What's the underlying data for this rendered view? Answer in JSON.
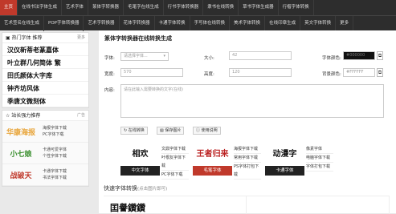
{
  "nav": {
    "row1": [
      "主页",
      "在线书法字体生成",
      "艺术字体",
      "篆体字转换器",
      "毛笔字在线生成",
      "行书字体转换器",
      "隶书在线转换",
      "草书字体生成器",
      "行楷字体转换"
    ],
    "row2": [
      "艺术签名在线生成",
      "POP字体转换器",
      "艺术字转换器",
      "花体字转换器",
      "卡通字体转换",
      "手写体在线转换",
      "美术字体转换",
      "在线印章生成",
      "英文字体转换",
      "更多"
    ]
  },
  "sidebar": {
    "hot_title": "热门字体 推荐",
    "hot_more": "更多",
    "fonts": [
      "汉仪新蒂老篆嘉体",
      "叶立群几何简体 繁",
      "田氏颜体大字库",
      "钟齐坊风体",
      "季唐文微刻体"
    ],
    "promo_title": "站长强力推荐",
    "promo_ad": "广告",
    "promos": [
      {
        "art": "华康海报",
        "links": [
          "海报字体下载",
          "PC字体下载"
        ],
        "color": "#e8a53a"
      },
      {
        "art": "小七娘",
        "links": [
          "卡通可爱字体",
          "个性字体下载"
        ],
        "color": "#3a8f2e"
      },
      {
        "art": "战破天",
        "links": [
          "卡通字体下载",
          "书法字体下载"
        ],
        "color": "#c0392b"
      }
    ]
  },
  "main": {
    "title": "篆体字转换器在线转换生成",
    "font_label": "字体:",
    "font_value": "请选择字体...",
    "size_label": "大小:",
    "size_value": "42",
    "color_label": "字体颜色:",
    "color_value": "#000000",
    "width_label": "宽度:",
    "width_value": "570",
    "height_label": "高度:",
    "height_value": "120",
    "bg_label": "背景颜色:",
    "bg_value": "#FFFFFF",
    "content_label": "内容:",
    "content_placeholder": "请在此输入需要转换的文字(在线)",
    "btn_convert": "在线转换",
    "btn_save": "保存图片",
    "btn_help": "使用说明",
    "samples": [
      {
        "art": "相欢",
        "cap": "中文字体",
        "capcolor": "#222",
        "links": [
          "文鼎字体下载",
          "叶根友字体下载",
          "PC字体下载"
        ]
      },
      {
        "art": "王者归来",
        "cap": "毛笔字体",
        "capcolor": "#c0392b",
        "links": [
          "海报字体下载",
          "常用字体下载",
          "PS字体打包下载"
        ]
      },
      {
        "art": "动漫字",
        "cap": "卡通字体",
        "capcolor": "#222",
        "links": [
          "像素字体",
          "电脑字体下载",
          "字体打包下载"
        ]
      }
    ],
    "section_title": "快速字体转换",
    "section_hint": "(点击图片即可)",
    "preview": [
      "囯譽鑽鑽",
      ""
    ]
  }
}
